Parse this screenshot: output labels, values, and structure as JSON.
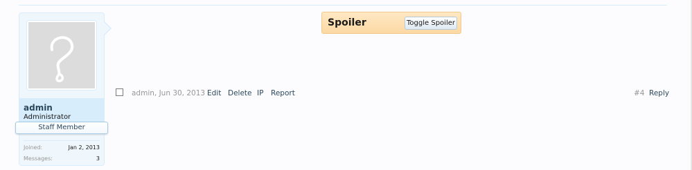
{
  "user": {
    "username": "admin",
    "title": "Administrator",
    "staff_banner": "Staff Member",
    "joined_label": "Joined:",
    "joined_value": "Jan 2, 2013",
    "messages_label": "Messages:",
    "messages_value": "3"
  },
  "spoiler": {
    "title": "Spoiler",
    "toggle_label": "Toggle Spoiler"
  },
  "meta": {
    "author_date": "admin, Jun 30, 2013",
    "edit_label": "Edit",
    "delete_label": "Delete",
    "ip_label": "IP",
    "report_label": "Report",
    "post_number": "#4",
    "reply_label": "Reply"
  },
  "colors": {
    "accent": "#2b485c",
    "panel_bg": "#f0f7fc",
    "panel_border": "#d7edfc",
    "spoiler_bg": "#fcd9a4"
  }
}
